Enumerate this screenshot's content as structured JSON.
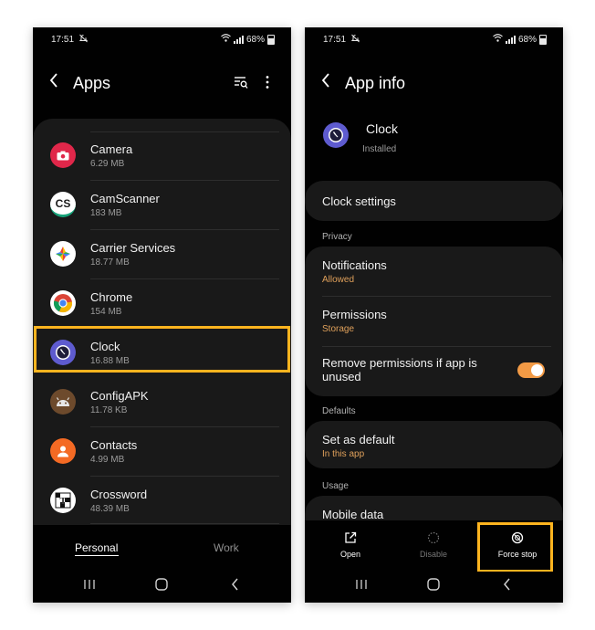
{
  "left_screen": {
    "status": {
      "time": "17:51",
      "battery": "68%"
    },
    "title": "Apps",
    "apps": [
      {
        "name": "Camera",
        "size": "6.29 MB",
        "icon": "camera-icon",
        "color": "#e0274a"
      },
      {
        "name": "CamScanner",
        "size": "183 MB",
        "icon": "camscanner-icon",
        "color": "#ffffff"
      },
      {
        "name": "Carrier Services",
        "size": "18.77 MB",
        "icon": "carrier-services-icon",
        "color": "#ffffff"
      },
      {
        "name": "Chrome",
        "size": "154 MB",
        "icon": "chrome-icon",
        "color": "#ffffff"
      },
      {
        "name": "Clock",
        "size": "16.88 MB",
        "icon": "clock-icon",
        "color": "#5e5bcf"
      },
      {
        "name": "ConfigAPK",
        "size": "11.78 KB",
        "icon": "android-icon",
        "color": "#6d4a2c"
      },
      {
        "name": "Contacts",
        "size": "4.99 MB",
        "icon": "contacts-icon",
        "color": "#f46a24"
      },
      {
        "name": "Crossword",
        "size": "48.39 MB",
        "icon": "crossword-icon",
        "color": "#ffffff"
      }
    ],
    "tabs": {
      "personal": "Personal",
      "work": "Work"
    }
  },
  "right_screen": {
    "status": {
      "time": "17:51",
      "battery": "68%"
    },
    "title": "App info",
    "app": {
      "name": "Clock",
      "status": "Installed"
    },
    "clock_settings": "Clock settings",
    "privacy_header": "Privacy",
    "notifications": {
      "label": "Notifications",
      "value": "Allowed"
    },
    "permissions": {
      "label": "Permissions",
      "value": "Storage"
    },
    "remove_permissions": {
      "label": "Remove permissions if app is unused",
      "enabled": true
    },
    "defaults_header": "Defaults",
    "set_default": {
      "label": "Set as default",
      "value": "In this app"
    },
    "usage_header": "Usage",
    "mobile_data": "Mobile data",
    "actions": {
      "open": "Open",
      "disable": "Disable",
      "force_stop": "Force stop"
    }
  },
  "colors": {
    "highlight": "#ffb41f",
    "accent": "#e0a15b",
    "toggle": "#f29a45",
    "panel": "#191919",
    "background": "#010101"
  }
}
